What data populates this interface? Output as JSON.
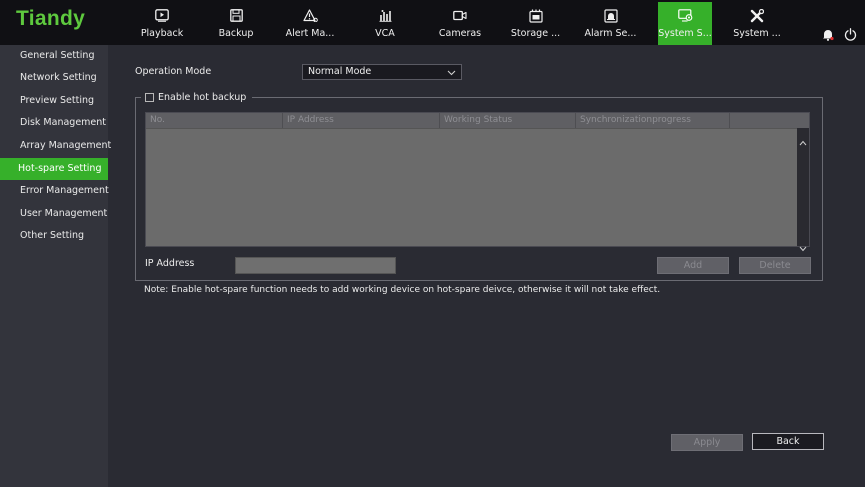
{
  "app": {
    "logo": "Tiandy"
  },
  "nav": {
    "items": [
      {
        "label": "Playback",
        "icon": "playback-icon"
      },
      {
        "label": "Backup",
        "icon": "save-icon"
      },
      {
        "label": "Alert Ma...",
        "icon": "alert-icon"
      },
      {
        "label": "VCA",
        "icon": "vca-icon"
      },
      {
        "label": "Cameras",
        "icon": "camera-icon"
      },
      {
        "label": "Storage ...",
        "icon": "storage-icon"
      },
      {
        "label": "Alarm Se...",
        "icon": "alarm-icon"
      },
      {
        "label": "System S...",
        "icon": "system-settings-icon",
        "active": true
      },
      {
        "label": "System ...",
        "icon": "tools-icon"
      }
    ]
  },
  "sidebar": {
    "items": [
      {
        "label": "General Setting"
      },
      {
        "label": "Network Setting"
      },
      {
        "label": "Preview Setting"
      },
      {
        "label": "Disk Management"
      },
      {
        "label": "Array Management"
      },
      {
        "label": "Hot-spare Setting",
        "active": true
      },
      {
        "label": "Error Management"
      },
      {
        "label": "User Management"
      },
      {
        "label": "Other Setting"
      }
    ]
  },
  "main": {
    "operation_mode_label": "Operation Mode",
    "operation_mode_value": "Normal Mode",
    "enable_hot_backup_label": "Enable hot backup",
    "enable_hot_backup_checked": false,
    "table": {
      "columns": [
        "No.",
        "IP Address",
        "Working Status",
        "Synchronizationprogress"
      ],
      "rows": []
    },
    "ip_address_label": "IP Address",
    "ip_address_value": "",
    "add_label": "Add",
    "delete_label": "Delete",
    "note": "Note: Enable hot-spare function needs to add working device on hot-spare deivce, otherwise it will not take effect.",
    "apply_label": "Apply",
    "back_label": "Back"
  },
  "colors": {
    "accent": "#36b02a",
    "logo": "#5ec93e",
    "topbar": "#101014",
    "sidebar": "#33343c",
    "content": "#2a2b33"
  }
}
